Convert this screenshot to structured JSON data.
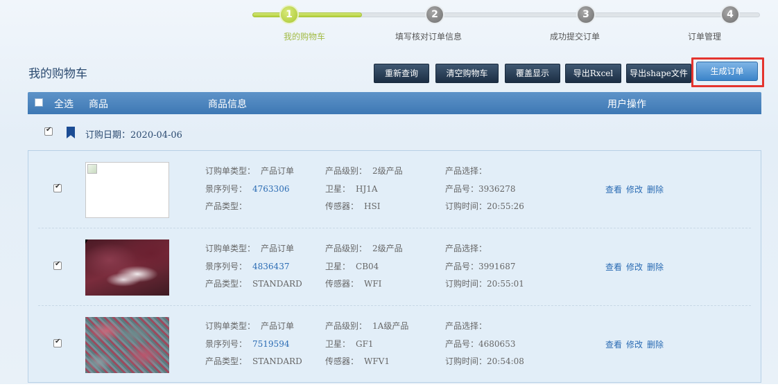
{
  "steps": [
    {
      "num": "1",
      "label": "我的购物车"
    },
    {
      "num": "2",
      "label": "填写核对订单信息"
    },
    {
      "num": "3",
      "label": "成功提交订单"
    },
    {
      "num": "4",
      "label": "订单管理"
    }
  ],
  "page_title": "我的购物车",
  "toolbar": {
    "requery": "重新查询",
    "clear_cart": "清空购物车",
    "overlay_display": "覆盖显示",
    "export_excel": "导出Rxcel",
    "export_shape": "导出shape文件",
    "generate_order": "生成订单"
  },
  "table_header": {
    "select_all": "全选",
    "product": "商品",
    "product_info": "商品信息",
    "user_actions": "用户操作"
  },
  "order_date": "订购日期：2020-04-06",
  "field_labels": {
    "order_type": "订购单类型：",
    "product_level": "产品级别：",
    "product_selection": "产品选择：",
    "scene_serial": "景序列号：",
    "satellite": "卫星：",
    "product_no": "产品号：",
    "product_type": "产品类型：",
    "sensor": "传感器：",
    "order_time": "订购时间："
  },
  "actions": {
    "view": "查看",
    "edit": "修改",
    "delete": "删除"
  },
  "items": [
    {
      "checked": true,
      "thumbnail": "broken-image",
      "order_type": "产品订单",
      "product_level": "2级产品",
      "product_selection": "",
      "scene_serial": "4763306",
      "satellite": "HJ1A",
      "product_no": "3936278",
      "product_type": "",
      "sensor": "HSI",
      "order_time": "20:55:26"
    },
    {
      "checked": true,
      "thumbnail": "satellite-image",
      "order_type": "产品订单",
      "product_level": "2级产品",
      "product_selection": "",
      "scene_serial": "4836437",
      "satellite": "CB04",
      "product_no": "3991687",
      "product_type": "STANDARD",
      "sensor": "WFI",
      "order_time": "20:55:01"
    },
    {
      "checked": true,
      "thumbnail": "satellite-image",
      "order_type": "产品订单",
      "product_level": "1A级产品",
      "product_selection": "",
      "scene_serial": "7519594",
      "satellite": "GF1",
      "product_no": "4680653",
      "product_type": "STANDARD",
      "sensor": "WFV1",
      "order_time": "20:54:08"
    }
  ],
  "colors": {
    "header_bar": "#4a83bd",
    "toolbar_button": "#2a3f57",
    "submit_button": "#5a9ad8",
    "highlight_box": "#e4342e",
    "active_step": "#b3cf3a",
    "link": "#2a6bb3"
  }
}
